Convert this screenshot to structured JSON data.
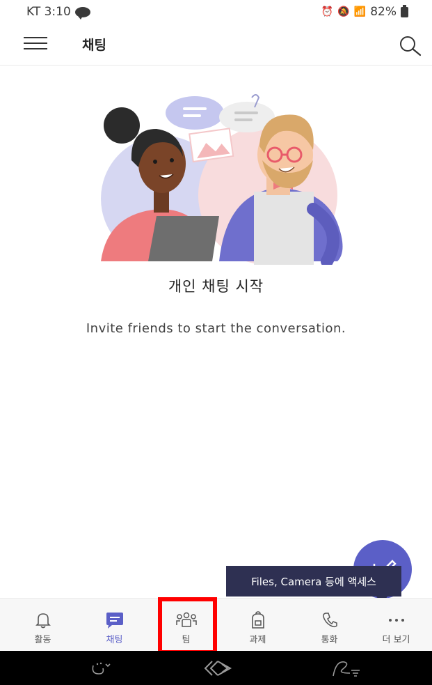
{
  "status_bar": {
    "carrier_time": "KT 3:10",
    "battery": "82%"
  },
  "header": {
    "title": "채팅"
  },
  "empty_state": {
    "title": "개인 채팅 시작",
    "subtitle": "Invite friends to start the conversation."
  },
  "tooltip": {
    "text": "Files, Camera 등에 액세스"
  },
  "tabs": [
    {
      "label": "활동",
      "icon": "bell-icon"
    },
    {
      "label": "채팅",
      "icon": "chat-icon"
    },
    {
      "label": "팀",
      "icon": "teams-icon"
    },
    {
      "label": "과제",
      "icon": "backpack-icon"
    },
    {
      "label": "통화",
      "icon": "phone-icon"
    },
    {
      "label": "더 보기",
      "icon": "more-icon"
    }
  ],
  "colors": {
    "accent": "#5b5fc7",
    "tooltip_bg": "#2e3052",
    "highlight": "#ff0000"
  }
}
